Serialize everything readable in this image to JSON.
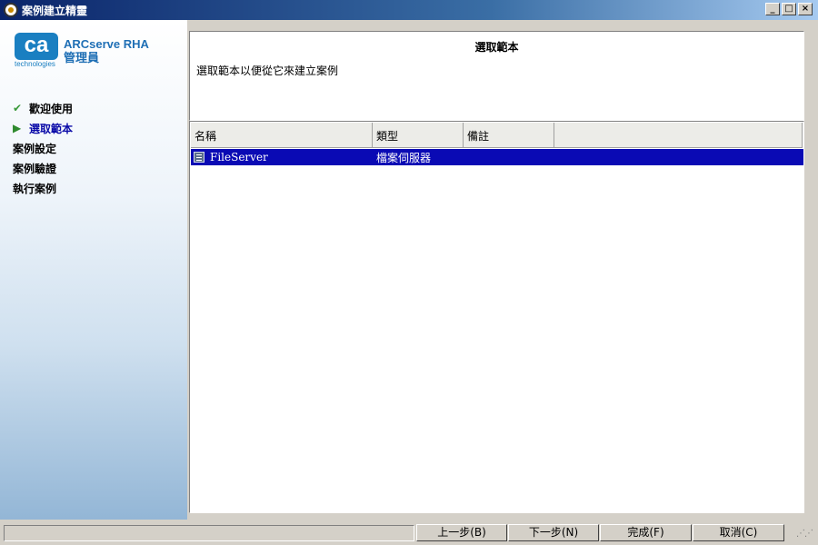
{
  "window": {
    "title": "案例建立精靈",
    "controls": {
      "minimize": "_",
      "maximize": "□",
      "close": "×"
    }
  },
  "brand": {
    "logo_text": "ca",
    "logo_subtext": "technologies",
    "product_line1": "ARCserve RHA",
    "product_line2": "管理員"
  },
  "steps": [
    {
      "label": "歡迎使用",
      "state": "done",
      "marker": "✔"
    },
    {
      "label": "選取範本",
      "state": "current",
      "marker": "▶"
    },
    {
      "label": "案例設定",
      "state": "pending",
      "marker": ""
    },
    {
      "label": "案例驗證",
      "state": "pending",
      "marker": ""
    },
    {
      "label": "執行案例",
      "state": "pending",
      "marker": ""
    }
  ],
  "header": {
    "title": "選取範本",
    "description": "選取範本以便從它來建立案例"
  },
  "table": {
    "columns": [
      "名稱",
      "類型",
      "備註",
      ""
    ],
    "rows": [
      {
        "name": "FileServer",
        "type": "檔案伺服器",
        "note": "",
        "icon": "server-icon",
        "selected": true
      }
    ]
  },
  "buttons": {
    "back": "上一步(B)",
    "next": "下一步(N)",
    "finish": "完成(F)",
    "cancel": "取消(C)"
  },
  "colors": {
    "selection": "#0a0ab4",
    "titlebar": "#0a246a",
    "brand": "#1a7fc1"
  }
}
